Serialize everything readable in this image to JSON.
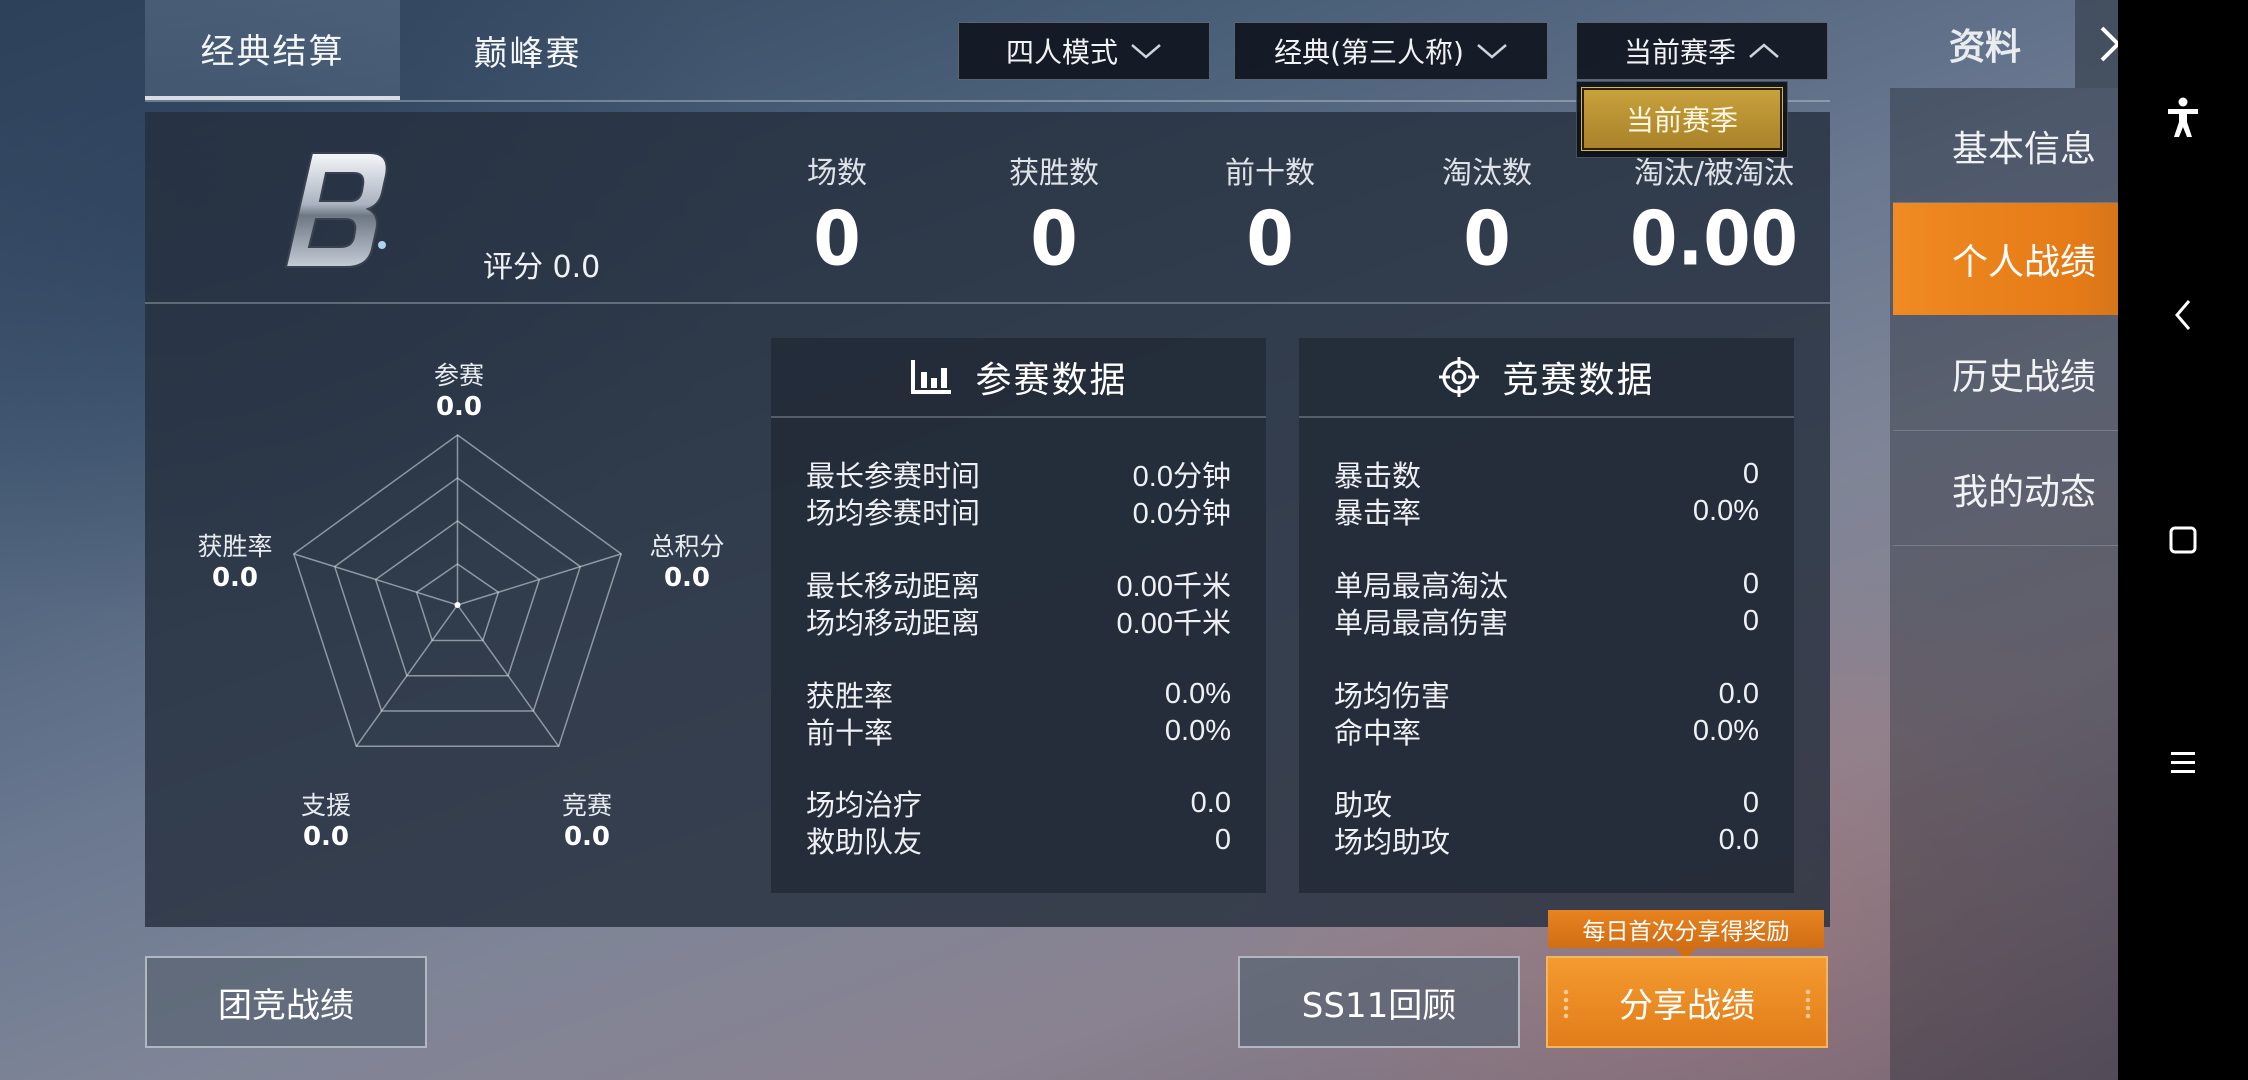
{
  "tabs": [
    {
      "label": "经典结算",
      "active": true
    },
    {
      "label": "巅峰赛",
      "active": false
    }
  ],
  "filters": {
    "mode": "四人模式",
    "perspective": "经典(第三人称)",
    "season": "当前赛季",
    "season_options": [
      "当前赛季"
    ]
  },
  "summary": {
    "rank_letter": "B",
    "rating_label": "评分 0.0",
    "stats": [
      {
        "label": "场数",
        "value": "0"
      },
      {
        "label": "获胜数",
        "value": "0"
      },
      {
        "label": "前十数",
        "value": "0"
      },
      {
        "label": "淘汰数",
        "value": "0"
      },
      {
        "label": "淘汰/被淘汰",
        "value": "0.00"
      }
    ]
  },
  "radar": {
    "axes": [
      {
        "label": "参赛",
        "value": "0.0"
      },
      {
        "label": "总积分",
        "value": "0.0"
      },
      {
        "label": "竞赛",
        "value": "0.0"
      },
      {
        "label": "支援",
        "value": "0.0"
      },
      {
        "label": "获胜率",
        "value": "0.0"
      }
    ]
  },
  "participation": {
    "title": "参赛数据",
    "icon": "bar-chart-icon",
    "rows": [
      {
        "label": "最长参赛时间",
        "value": "0.0分钟"
      },
      {
        "label": "场均参赛时间",
        "value": "0.0分钟"
      },
      {
        "label": "最长移动距离",
        "value": "0.00千米"
      },
      {
        "label": "场均移动距离",
        "value": "0.00千米"
      },
      {
        "label": "获胜率",
        "value": "0.0%"
      },
      {
        "label": "前十率",
        "value": "0.0%"
      },
      {
        "label": "场均治疗",
        "value": "0.0"
      },
      {
        "label": "救助队友",
        "value": "0"
      }
    ]
  },
  "competition": {
    "title": "竞赛数据",
    "icon": "crosshair-icon",
    "rows": [
      {
        "label": "暴击数",
        "value": "0"
      },
      {
        "label": "暴击率",
        "value": "0.0%"
      },
      {
        "label": "单局最高淘汰",
        "value": "0"
      },
      {
        "label": "单局最高伤害",
        "value": "0"
      },
      {
        "label": "场均伤害",
        "value": "0.0"
      },
      {
        "label": "命中率",
        "value": "0.0%"
      },
      {
        "label": "助攻",
        "value": "0"
      },
      {
        "label": "场均助攻",
        "value": "0.0"
      }
    ]
  },
  "side_menu": {
    "title": "资料",
    "items": [
      {
        "label": "基本信息",
        "active": false
      },
      {
        "label": "个人战绩",
        "active": true
      },
      {
        "label": "历史战绩",
        "active": false
      },
      {
        "label": "我的动态",
        "active": false
      }
    ]
  },
  "buttons": {
    "team_record": "团竞战绩",
    "season_review": "SS11回顾",
    "share_record": "分享战绩",
    "share_tooltip": "每日首次分享得奖励"
  },
  "colors": {
    "accent_orange": "#e98520",
    "gold_option": "#c8a13c"
  }
}
